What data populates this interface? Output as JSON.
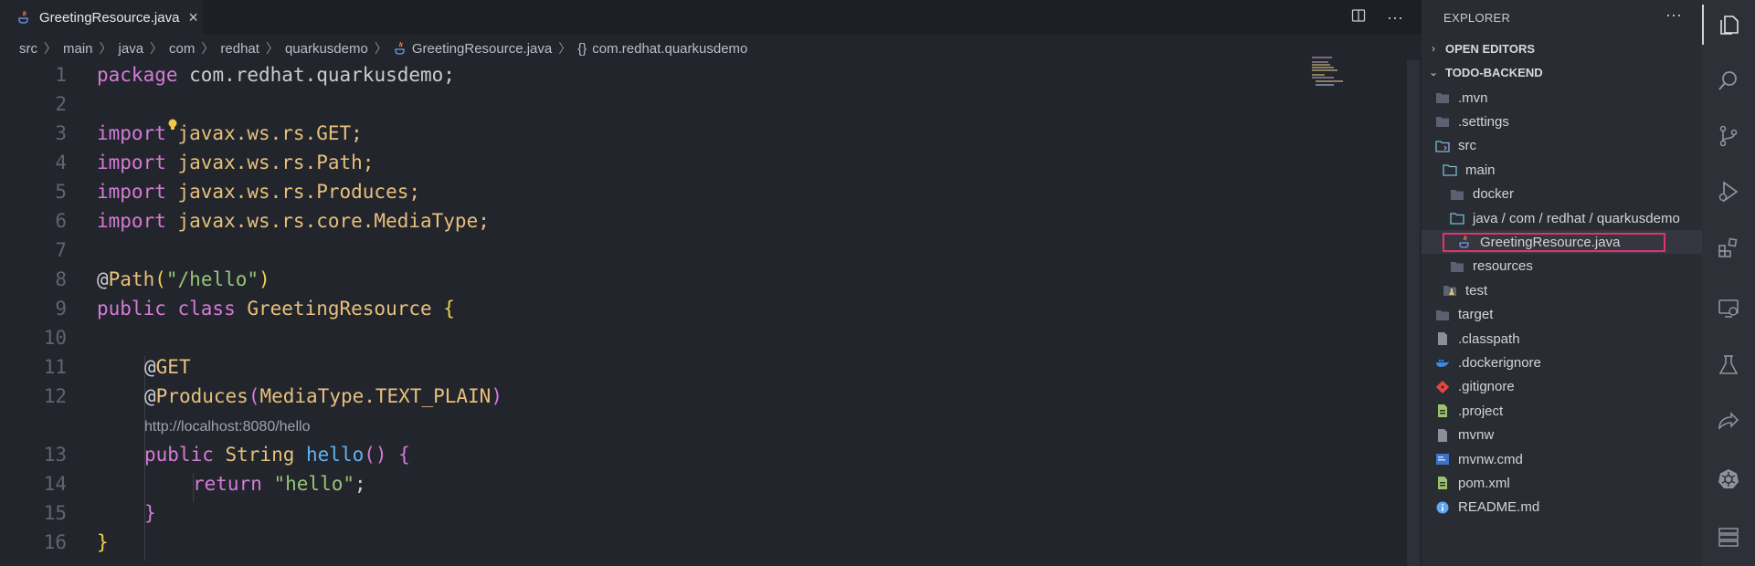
{
  "editor": {
    "tab": {
      "label": "GreetingResource.java",
      "close": "×"
    },
    "actions": {
      "split": "◫",
      "more": "···"
    },
    "breadcrumb": {
      "segments": [
        "src",
        "main",
        "java",
        "com",
        "redhat",
        "quarkusdemo"
      ],
      "file": "GreetingResource.java",
      "braces": "{}",
      "symbol": "com.redhat.quarkusdemo"
    },
    "line_numbers": [
      "1",
      "2",
      "3",
      "4",
      "5",
      "6",
      "7",
      "8",
      "9",
      "10",
      "11",
      "12",
      "13",
      "14",
      "15",
      "16"
    ],
    "code": {
      "l1": {
        "kw": "package",
        "rest": " com.redhat.quarkusdemo;"
      },
      "l3": {
        "kw": "import",
        "rest": " javax.ws.rs.GET;"
      },
      "l4": {
        "kw": "import",
        "rest": " javax.ws.rs.Path;"
      },
      "l5": {
        "kw": "import",
        "rest": " javax.ws.rs.Produces;"
      },
      "l6": {
        "kw": "import",
        "rest": " javax.ws.rs.core.MediaType;"
      },
      "l8": {
        "at": "@",
        "name": "Path",
        "open": "(",
        "str": "\"/hello\"",
        "close": ")"
      },
      "l9": {
        "kw": "public class",
        "name": " GreetingResource",
        "brace": " {"
      },
      "l11": {
        "at": "@",
        "name": "GET"
      },
      "l12": {
        "at": "@",
        "name": "Produces",
        "open": "(",
        "arg": "MediaType.TEXT_PLAIN",
        "close": ")"
      },
      "codelens": "http://localhost:8080/hello",
      "l13": {
        "kw": "public",
        "type": " String",
        "fn": " hello",
        "parens": "()",
        "brace": " {"
      },
      "l14": {
        "kw": "return",
        "str": " \"hello\"",
        "semi": ";"
      },
      "l15": {
        "brace": "}"
      },
      "l16": {
        "brace": "}"
      }
    }
  },
  "explorer": {
    "title": "EXPLORER",
    "more": "···",
    "open_editors": "OPEN EDITORS",
    "project": "TODO-BACKEND",
    "tree": [
      {
        "label": ".mvn",
        "icon": "folder-icon"
      },
      {
        "label": ".settings",
        "icon": "folder-icon"
      },
      {
        "label": "src",
        "icon": "src-folder-icon"
      },
      {
        "label": "main",
        "icon": "folder-open-icon"
      },
      {
        "label": "docker",
        "icon": "folder-icon"
      },
      {
        "label": "java / com / redhat / quarkusdemo",
        "icon": "folder-open-icon"
      },
      {
        "label": "GreetingResource.java",
        "icon": "java-icon"
      },
      {
        "label": "resources",
        "icon": "folder-icon"
      },
      {
        "label": "test",
        "icon": "test-folder-icon"
      },
      {
        "label": "target",
        "icon": "folder-icon"
      },
      {
        "label": ".classpath",
        "icon": "classpath-icon"
      },
      {
        "label": ".dockerignore",
        "icon": "docker-icon"
      },
      {
        "label": ".gitignore",
        "icon": "git-icon"
      },
      {
        "label": ".project",
        "icon": "eclipse-icon"
      },
      {
        "label": "mvnw",
        "icon": "file-icon"
      },
      {
        "label": "mvnw.cmd",
        "icon": "cmd-icon"
      },
      {
        "label": "pom.xml",
        "icon": "maven-icon"
      },
      {
        "label": "README.md",
        "icon": "info-icon"
      }
    ]
  },
  "colors": {
    "keyword": "#d57bd8",
    "type": "#e6c07b",
    "function": "#5fb3f3",
    "string": "#98c379",
    "highlight_box": "#e0336a"
  }
}
